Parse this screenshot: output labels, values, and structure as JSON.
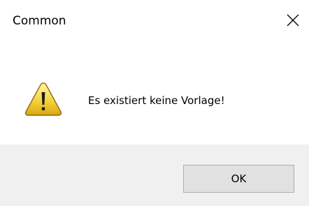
{
  "window": {
    "title": "Common",
    "close_icon": "close-icon"
  },
  "content": {
    "icon": "warning-icon",
    "message": "Es existiert keine Vorlage!"
  },
  "footer": {
    "ok_label": "OK"
  }
}
